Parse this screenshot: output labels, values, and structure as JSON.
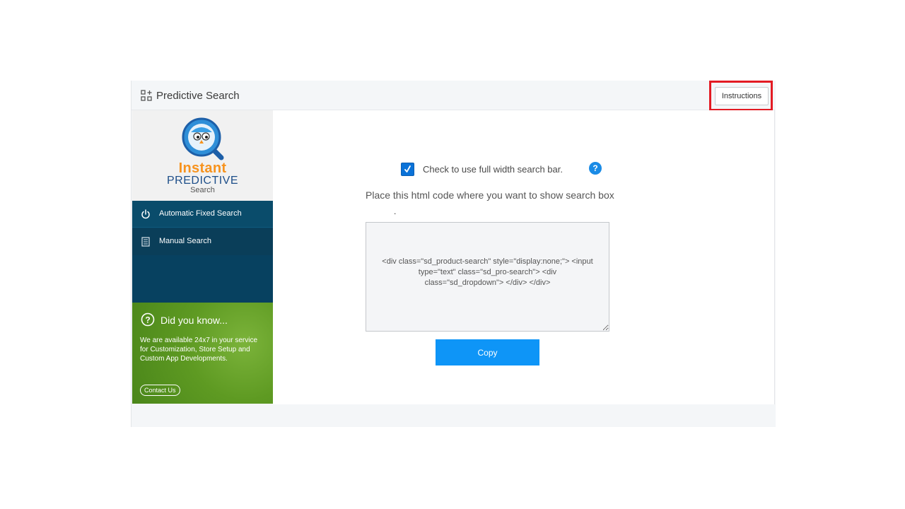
{
  "header": {
    "title": "Predictive Search",
    "instructions_label": "Instructions"
  },
  "logo": {
    "line1": "Instant",
    "line2": "PREDICTIVE",
    "line3": "Search"
  },
  "sidebar": {
    "items": [
      {
        "label": "Automatic Fixed Search",
        "icon": "power-icon"
      },
      {
        "label": "Manual Search",
        "icon": "document-icon"
      }
    ]
  },
  "did_you_know": {
    "heading": "Did you know...",
    "body": "We are available 24x7 in your service for Customization, Store Setup and Custom App Developments.",
    "contact_label": "Contact Us"
  },
  "main": {
    "checkbox_checked": true,
    "checkbox_label": "Check to use full width search bar.",
    "help_glyph": "?",
    "instruction": "Place this html code where you want to show search box",
    "dot": ".",
    "code": "<div class=\"sd_product-search\" style=\"display:none;\"> <input type=\"text\" class=\"sd_pro-search\"> <div class=\"sd_dropdown\"> </div> </div>",
    "copy_label": "Copy"
  },
  "colors": {
    "nav_bg": "#074160",
    "accent_blue": "#0e95f7",
    "dyk_green": "#5e9a22",
    "logo_orange": "#f7931e",
    "highlight_red": "#e31b23"
  }
}
